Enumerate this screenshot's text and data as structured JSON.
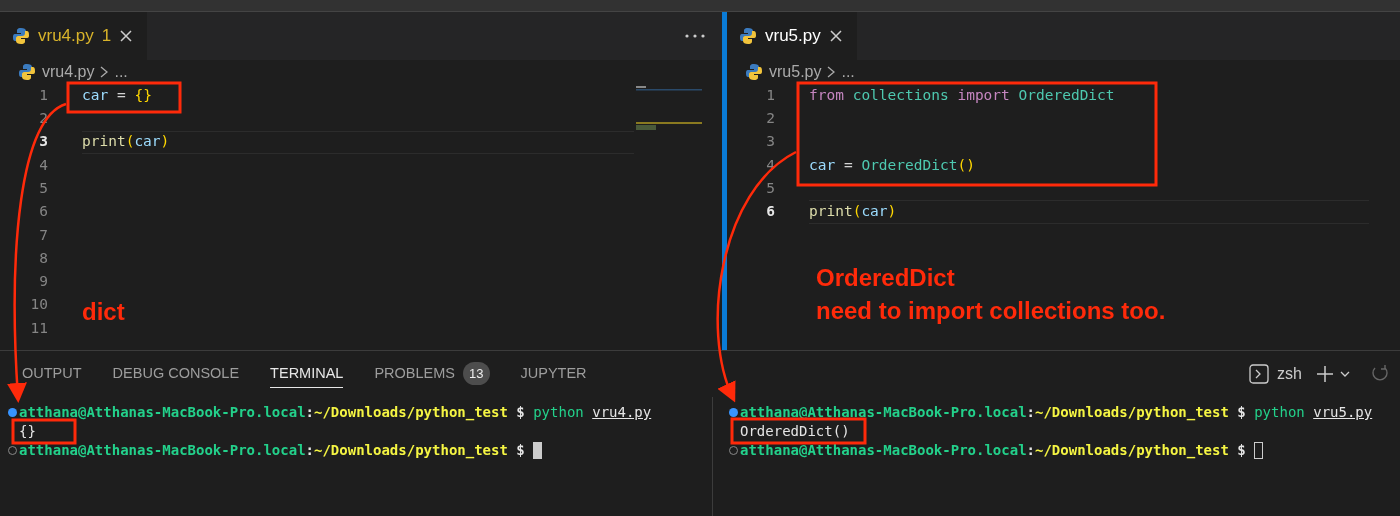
{
  "editors": [
    {
      "tab": {
        "label": "vru4.py",
        "count": "1",
        "warning": true
      },
      "breadcrumb": {
        "file": "vru4.py",
        "rest": "..."
      },
      "minimap": true,
      "lines": [
        {
          "number": "1",
          "current": false,
          "tokens": [
            {
              "text": "car",
              "kind": "variable"
            },
            {
              "text": " = ",
              "kind": "operator"
            },
            {
              "text": "{}",
              "kind": "bracket"
            }
          ]
        },
        {
          "number": "2",
          "current": false
        },
        {
          "number": "3",
          "current": true,
          "tokens": [
            {
              "text": "print",
              "kind": "function"
            },
            {
              "text": "(",
              "kind": "bracket"
            },
            {
              "text": "car",
              "kind": "variable"
            },
            {
              "text": ")",
              "kind": "bracket"
            }
          ]
        },
        {
          "number": "4",
          "current": false
        },
        {
          "number": "5",
          "current": false
        },
        {
          "number": "6",
          "current": false
        },
        {
          "number": "7",
          "current": false
        },
        {
          "number": "8",
          "current": false
        },
        {
          "number": "9",
          "current": false
        },
        {
          "number": "10",
          "current": false
        },
        {
          "number": "11",
          "current": false
        }
      ],
      "notes": [
        "dict"
      ]
    },
    {
      "tab": {
        "label": "vru5.py",
        "warning": false
      },
      "breadcrumb": {
        "file": "vru5.py",
        "rest": "..."
      },
      "lines": [
        {
          "number": "1",
          "current": false,
          "tokens": [
            {
              "text": "from ",
              "kind": "keyword"
            },
            {
              "text": "collections ",
              "kind": "class"
            },
            {
              "text": "import ",
              "kind": "keyword"
            },
            {
              "text": "OrderedDict",
              "kind": "class"
            }
          ]
        },
        {
          "number": "2",
          "current": false
        },
        {
          "number": "3",
          "current": false
        },
        {
          "number": "4",
          "current": false,
          "tokens": [
            {
              "text": "car",
              "kind": "variable"
            },
            {
              "text": " = ",
              "kind": "operator"
            },
            {
              "text": "OrderedDict",
              "kind": "class"
            },
            {
              "text": "()",
              "kind": "bracket"
            }
          ]
        },
        {
          "number": "5",
          "current": false
        },
        {
          "number": "6",
          "current": true,
          "tokens": [
            {
              "text": "print",
              "kind": "function"
            },
            {
              "text": "(",
              "kind": "bracket"
            },
            {
              "text": "car",
              "kind": "variable"
            },
            {
              "text": ")",
              "kind": "bracket"
            }
          ]
        }
      ],
      "notes": [
        "OrderedDict",
        "need to import collections too."
      ]
    }
  ],
  "panel": {
    "tabs": [
      {
        "label": "OUTPUT",
        "selected": false
      },
      {
        "label": "DEBUG CONSOLE",
        "selected": false
      },
      {
        "label": "TERMINAL",
        "selected": true
      },
      {
        "label": "PROBLEMS",
        "selected": false,
        "count": "13"
      },
      {
        "label": "JUPYTER",
        "selected": false
      }
    ],
    "shell": "zsh",
    "terminals": [
      {
        "lines": [
          {
            "kind": "command",
            "tokens": [
              {
                "text": "atthana@Atthanas-MacBook-Pro.local",
                "kind": "user"
              },
              {
                "text": ":",
                "kind": "sep"
              },
              {
                "text": "~/Downloads/python_test",
                "kind": "path"
              },
              {
                "text": " $ ",
                "kind": "sep"
              },
              {
                "text": "python ",
                "kind": "cmd"
              },
              {
                "text": "vru4.py",
                "kind": "arg"
              }
            ]
          },
          {
            "kind": "output",
            "tokens": [
              {
                "text": "{}",
                "kind": "output"
              }
            ]
          },
          {
            "kind": "prompt",
            "tokens": [
              {
                "text": "atthana@Atthanas-MacBook-Pro.local",
                "kind": "user"
              },
              {
                "text": ":",
                "kind": "sep"
              },
              {
                "text": "~/Downloads/python_test",
                "kind": "path"
              },
              {
                "text": " $ ",
                "kind": "sep"
              },
              {
                "kind": "cursor-filled"
              }
            ]
          }
        ]
      },
      {
        "lines": [
          {
            "kind": "command",
            "tokens": [
              {
                "text": "atthana@Atthanas-MacBook-Pro.local",
                "kind": "user"
              },
              {
                "text": ":",
                "kind": "sep"
              },
              {
                "text": "~/Downloads/python_test",
                "kind": "path"
              },
              {
                "text": " $ ",
                "kind": "sep"
              },
              {
                "text": "python ",
                "kind": "cmd"
              },
              {
                "text": "vru5.py",
                "kind": "arg"
              }
            ]
          },
          {
            "kind": "output",
            "tokens": [
              {
                "text": "OrderedDict()",
                "kind": "output"
              }
            ]
          },
          {
            "kind": "prompt",
            "tokens": [
              {
                "text": "atthana@Atthanas-MacBook-Pro.local",
                "kind": "user"
              },
              {
                "text": ":",
                "kind": "sep"
              },
              {
                "text": "~/Downloads/python_test",
                "kind": "path"
              },
              {
                "text": " $ ",
                "kind": "sep"
              },
              {
                "kind": "cursor-hollow"
              }
            ]
          }
        ]
      }
    ]
  }
}
